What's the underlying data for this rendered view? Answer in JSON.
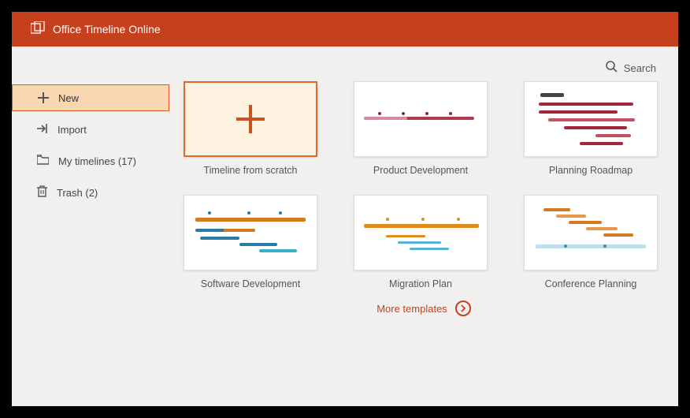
{
  "header": {
    "title": "Office Timeline Online"
  },
  "search": {
    "label": "Search"
  },
  "sidebar": {
    "items": [
      {
        "label": "New",
        "icon": "plus",
        "active": true
      },
      {
        "label": "Import",
        "icon": "import"
      },
      {
        "label": "My timelines (17)",
        "icon": "folder"
      },
      {
        "label": "Trash (2)",
        "icon": "trash"
      }
    ]
  },
  "templates": [
    {
      "label": "Timeline from scratch",
      "kind": "scratch"
    },
    {
      "label": "Product Development",
      "kind": "line-red"
    },
    {
      "label": "Planning Roadmap",
      "kind": "gantt-red"
    },
    {
      "label": "Software Development",
      "kind": "gantt-blue"
    },
    {
      "label": "Migration Plan",
      "kind": "line-orange"
    },
    {
      "label": "Conference Planning",
      "kind": "gantt-orange"
    }
  ],
  "more": {
    "label": "More templates"
  },
  "colors": {
    "brand": "#c7401e",
    "accent_bg": "#f8d7b1",
    "scratch_bg": "#fdf2df"
  }
}
